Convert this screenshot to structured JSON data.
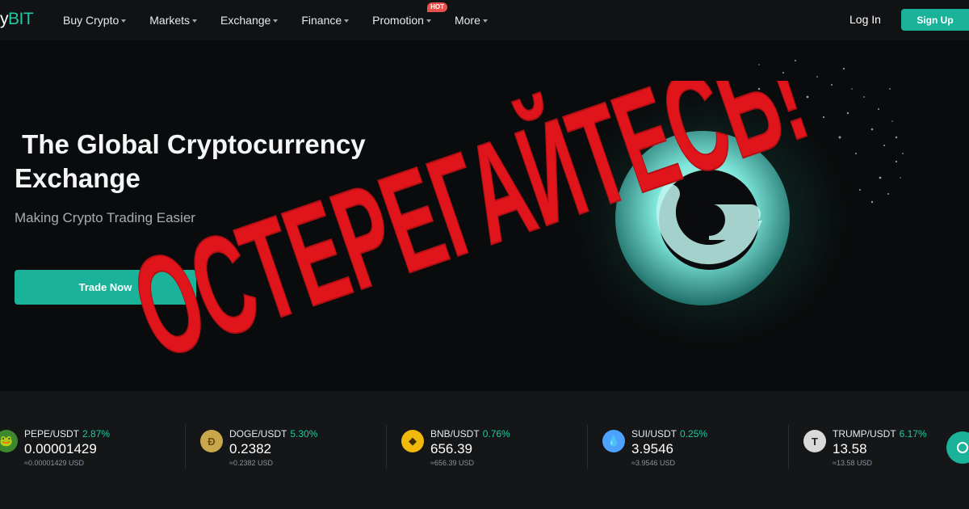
{
  "brand": {
    "logo_part1": "y",
    "logo_part2": "BIT"
  },
  "nav": {
    "items": [
      {
        "label": "Buy Crypto",
        "has_dropdown": true
      },
      {
        "label": "Markets",
        "has_dropdown": true
      },
      {
        "label": "Exchange",
        "has_dropdown": true
      },
      {
        "label": "Finance",
        "has_dropdown": true
      },
      {
        "label": "Promotion",
        "has_dropdown": true,
        "badge": "HOT"
      },
      {
        "label": "More",
        "has_dropdown": true
      }
    ],
    "login_label": "Log In",
    "signup_label": "Sign Up"
  },
  "hero": {
    "title": " The Global Cryptocurrency\nExchange",
    "subtitle": "Making Crypto Trading Easier",
    "cta_label": "Trade Now"
  },
  "overlay": {
    "warning_text": "ОСТЕРЕГАЙТЕСЬ!",
    "color": "#e0151b"
  },
  "ticker": [
    {
      "pair": "PEPE/USDT",
      "change": "2.87%",
      "price": "0.00001429",
      "usd": "≈0.00001429 USD",
      "icon": "pepe-icon",
      "icon_color": "#3d8a2e"
    },
    {
      "pair": "DOGE/USDT",
      "change": "5.30%",
      "price": "0.2382",
      "usd": "≈0.2382 USD",
      "icon": "doge-icon",
      "icon_color": "#c9a84c"
    },
    {
      "pair": "BNB/USDT",
      "change": "0.76%",
      "price": "656.39",
      "usd": "≈656.39 USD",
      "icon": "bnb-icon",
      "icon_color": "#f0b90b"
    },
    {
      "pair": "SUI/USDT",
      "change": "0.25%",
      "price": "3.9546",
      "usd": "≈3.9546 USD",
      "icon": "sui-icon",
      "icon_color": "#4da2ff"
    },
    {
      "pair": "TRUMP/USDT",
      "change": "6.17%",
      "price": "13.58",
      "usd": "≈13.58 USD",
      "icon": "trump-icon",
      "icon_color": "#d9d9d9"
    }
  ],
  "colors": {
    "accent": "#1ab399",
    "positive": "#1ec9a5",
    "hot_badge": "#e8504a"
  }
}
